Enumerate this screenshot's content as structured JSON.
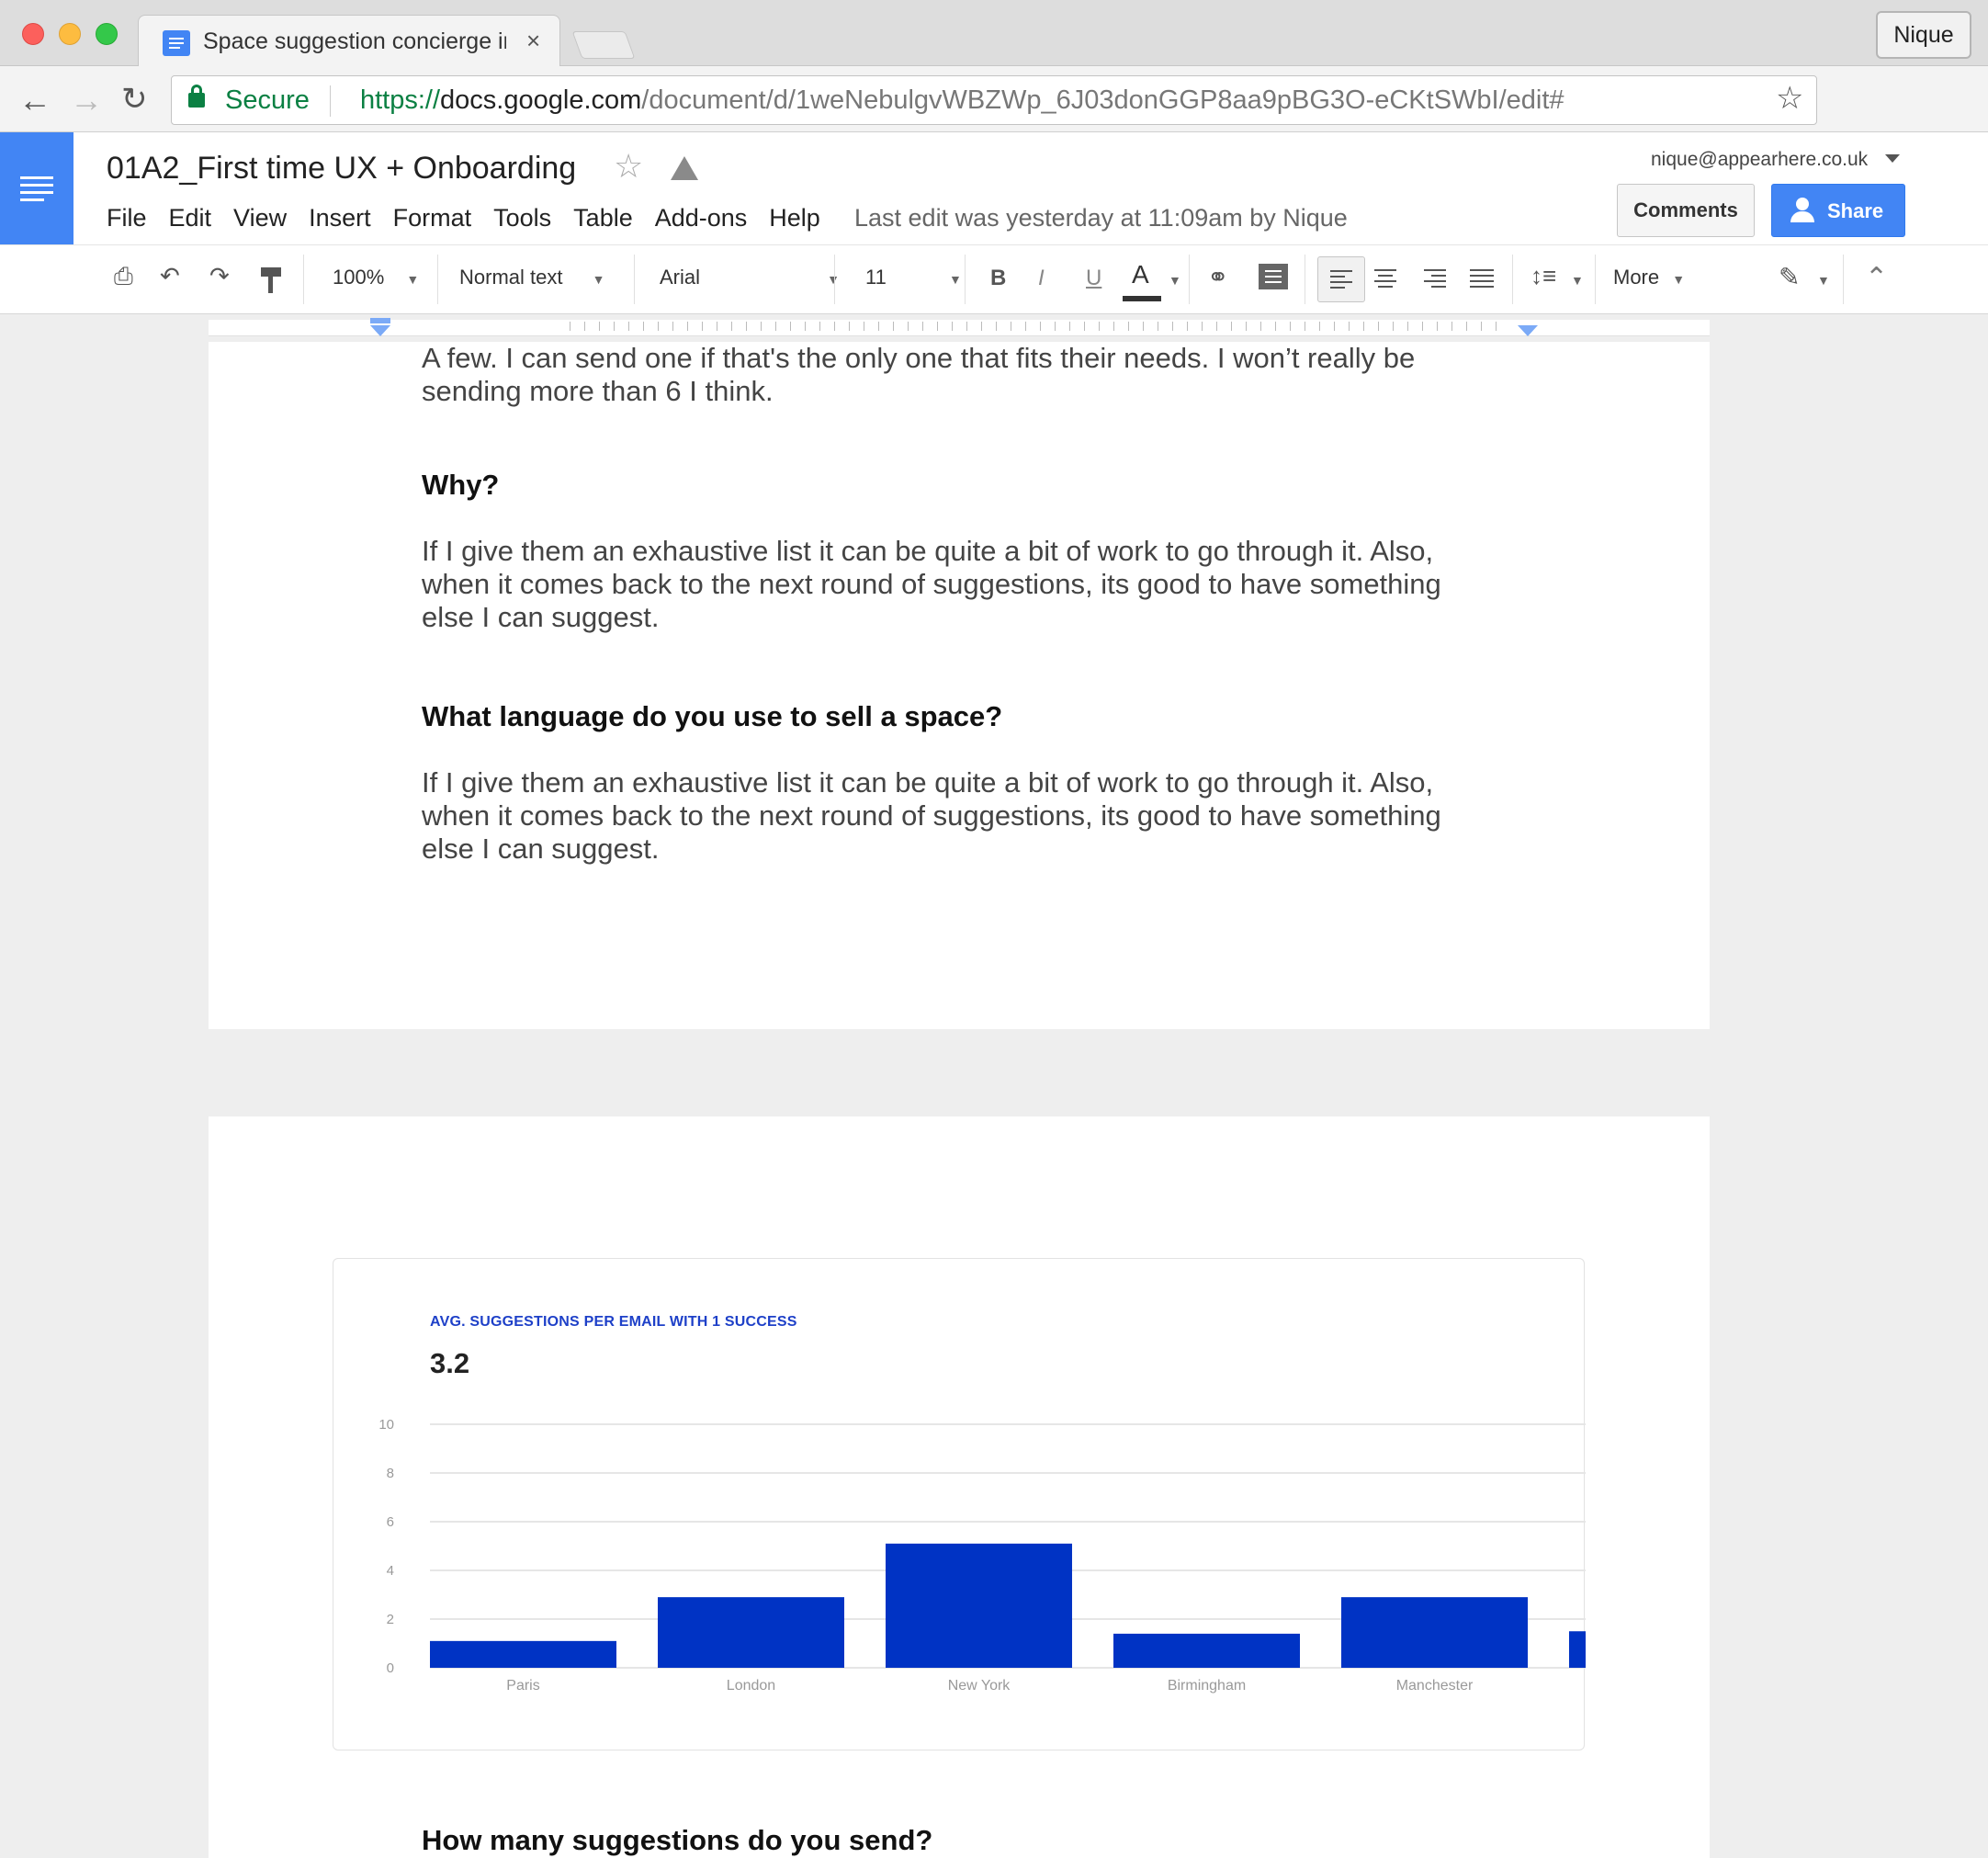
{
  "browser": {
    "tab_title": "Space suggestion concierge in",
    "tab_close": "×",
    "profile_name": "Nique",
    "secure_label": "Secure",
    "url_scheme": "https://",
    "url_domain": "docs.google.com",
    "url_path": "/document/d/1weNebulgvWBZWp_6J03donGGP8aa9pBG3O-eCKtSWbI/edit#"
  },
  "docs": {
    "title": "01A2_First time UX + Onboarding",
    "menu": [
      "File",
      "Edit",
      "View",
      "Insert",
      "Format",
      "Tools",
      "Table",
      "Add-ons",
      "Help"
    ],
    "last_edit": "Last edit was yesterday at 11:09am by Nique",
    "account_email": "nique@appearhere.co.uk",
    "comments_label": "Comments",
    "share_label": "Share"
  },
  "toolbar": {
    "zoom": "100%",
    "style": "Normal text",
    "font": "Arial",
    "size": "11",
    "bold": "B",
    "italic": "I",
    "underline": "U",
    "text_color": "A",
    "more": "More"
  },
  "document": {
    "p1": "A few.  I can send one if that's the only one that fits their needs.  I won’t really be sending more than 6 I think.",
    "h_why": "Why?",
    "p2": "If I give them an exhaustive list it can be quite a bit of work to go through it.  Also, when it comes back to the next round of suggestions, its good to have something else I can suggest.",
    "h_language": "What language do you use to sell a space?",
    "p3": "If I give them an exhaustive list it can be quite a bit of work to go through it.  Also, when it comes back to the next round of suggestions, its good to have something else I can suggest.",
    "h_bottom": "How many suggestions do you send?"
  },
  "chart_data": {
    "type": "bar",
    "title": "AVG. SUGGESTIONS PER EMAIL WITH 1 SUCCESS",
    "headline_value": "3.2",
    "categories": [
      "Paris",
      "London",
      "New York",
      "Birmingham",
      "Manchester",
      ""
    ],
    "values": [
      1.1,
      2.9,
      5.1,
      1.4,
      2.9,
      1.5
    ],
    "ylim": [
      0,
      10
    ],
    "yticks": [
      "0",
      "2",
      "4",
      "6",
      "8",
      "10"
    ],
    "grid": true,
    "bar_color": "#0033c4"
  }
}
